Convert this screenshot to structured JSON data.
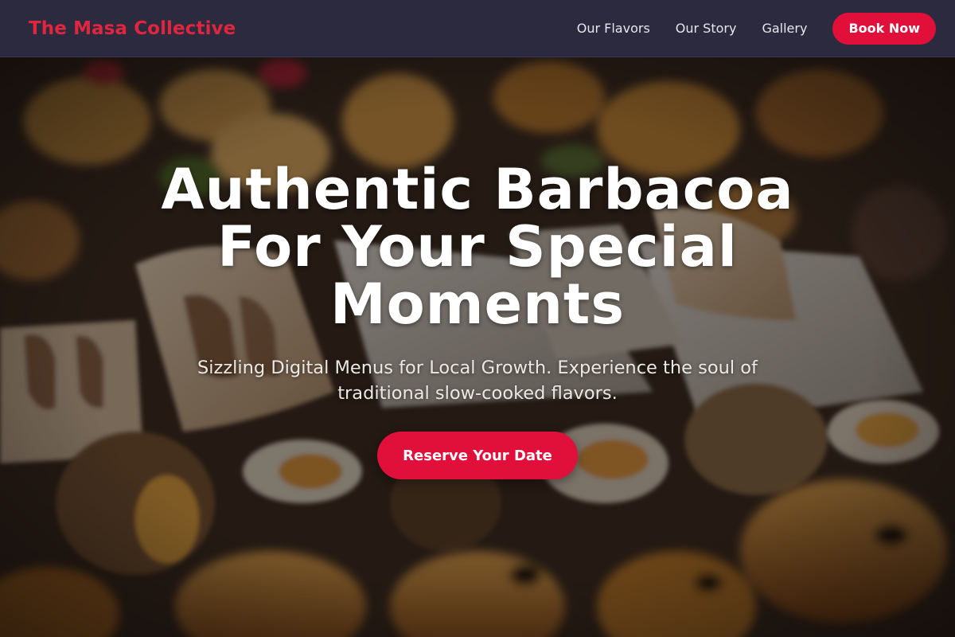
{
  "nav": {
    "brand": "The Masa Collective",
    "links": [
      "Our Flavors",
      "Our Story",
      "Gallery"
    ],
    "cta": "Book Now"
  },
  "hero": {
    "background_icon": "food-photo-background",
    "title": "Authentic Barbacoa For Your Special Moments",
    "subtitle": "Sizzling Digital Menus for Local Growth. Experience the soul of traditional slow-cooked flavors.",
    "cta": "Reserve Your Date"
  },
  "colors": {
    "accent": "#e0103a",
    "brand_text": "#e0253f",
    "nav_bg": "#2b2a3f"
  }
}
